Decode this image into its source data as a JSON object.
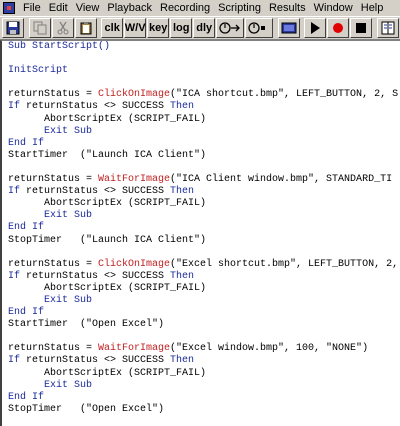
{
  "menubar": {
    "items": [
      "File",
      "Edit",
      "View",
      "Playback",
      "Recording",
      "Scripting",
      "Results",
      "Window",
      "Help"
    ]
  },
  "toolbar": {
    "text_buttons": [
      "clk",
      "W/V",
      "key",
      "log",
      "dly"
    ]
  },
  "code": [
    [
      {
        "t": "Sub StartScript()",
        "c": "kw"
      }
    ],
    [
      {
        "t": "",
        "c": "plain"
      }
    ],
    [
      {
        "t": "InitScript",
        "c": "kw"
      }
    ],
    [
      {
        "t": "",
        "c": "plain"
      }
    ],
    [
      {
        "t": "returnStatus = ",
        "c": "plain"
      },
      {
        "t": "ClickOnImage",
        "c": "fn"
      },
      {
        "t": "(\"ICA shortcut.bmp\", LEFT_BUTTON, 2, S",
        "c": "plain"
      }
    ],
    [
      {
        "t": "If",
        "c": "kw"
      },
      {
        "t": " returnStatus <> SUCCESS ",
        "c": "plain"
      },
      {
        "t": "Then",
        "c": "kw"
      }
    ],
    [
      {
        "t": "      AbortScriptEx (SCRIPT_FAIL)",
        "c": "plain"
      }
    ],
    [
      {
        "t": "      ",
        "c": "plain"
      },
      {
        "t": "Exit Sub",
        "c": "kw"
      }
    ],
    [
      {
        "t": "End If",
        "c": "kw"
      }
    ],
    [
      {
        "t": "StartTimer  (\"Launch ICA Client\")",
        "c": "plain"
      }
    ],
    [
      {
        "t": "",
        "c": "plain"
      }
    ],
    [
      {
        "t": "returnStatus = ",
        "c": "plain"
      },
      {
        "t": "WaitForImage",
        "c": "fn"
      },
      {
        "t": "(\"ICA Client window.bmp\", STANDARD_TI",
        "c": "plain"
      }
    ],
    [
      {
        "t": "If",
        "c": "kw"
      },
      {
        "t": " returnStatus <> SUCCESS ",
        "c": "plain"
      },
      {
        "t": "Then",
        "c": "kw"
      }
    ],
    [
      {
        "t": "      AbortScriptEx (SCRIPT_FAIL)",
        "c": "plain"
      }
    ],
    [
      {
        "t": "      ",
        "c": "plain"
      },
      {
        "t": "Exit Sub",
        "c": "kw"
      }
    ],
    [
      {
        "t": "End If",
        "c": "kw"
      }
    ],
    [
      {
        "t": "StopTimer   (\"Launch ICA Client\")",
        "c": "plain"
      }
    ],
    [
      {
        "t": "",
        "c": "plain"
      }
    ],
    [
      {
        "t": "returnStatus = ",
        "c": "plain"
      },
      {
        "t": "ClickOnImage",
        "c": "fn"
      },
      {
        "t": "(\"Excel shortcut.bmp\", LEFT_BUTTON, 2,",
        "c": "plain"
      }
    ],
    [
      {
        "t": "If",
        "c": "kw"
      },
      {
        "t": " returnStatus <> SUCCESS ",
        "c": "plain"
      },
      {
        "t": "Then",
        "c": "kw"
      }
    ],
    [
      {
        "t": "      AbortScriptEx (SCRIPT_FAIL)",
        "c": "plain"
      }
    ],
    [
      {
        "t": "      ",
        "c": "plain"
      },
      {
        "t": "Exit Sub",
        "c": "kw"
      }
    ],
    [
      {
        "t": "End If",
        "c": "kw"
      }
    ],
    [
      {
        "t": "StartTimer  (\"Open Excel\")",
        "c": "plain"
      }
    ],
    [
      {
        "t": "",
        "c": "plain"
      }
    ],
    [
      {
        "t": "returnStatus = ",
        "c": "plain"
      },
      {
        "t": "WaitForImage",
        "c": "fn"
      },
      {
        "t": "(\"Excel window.bmp\", 100, \"NONE\")",
        "c": "plain"
      }
    ],
    [
      {
        "t": "If",
        "c": "kw"
      },
      {
        "t": " returnStatus <> SUCCESS ",
        "c": "plain"
      },
      {
        "t": "Then",
        "c": "kw"
      }
    ],
    [
      {
        "t": "      AbortScriptEx (SCRIPT_FAIL)",
        "c": "plain"
      }
    ],
    [
      {
        "t": "      ",
        "c": "plain"
      },
      {
        "t": "Exit Sub",
        "c": "kw"
      }
    ],
    [
      {
        "t": "End If",
        "c": "kw"
      }
    ],
    [
      {
        "t": "StopTimer   (\"Open Excel\")",
        "c": "plain"
      }
    ]
  ],
  "colors": {
    "keyword": "#1a2a9a",
    "function": "#c02020",
    "chrome": "#d4d0c8"
  }
}
